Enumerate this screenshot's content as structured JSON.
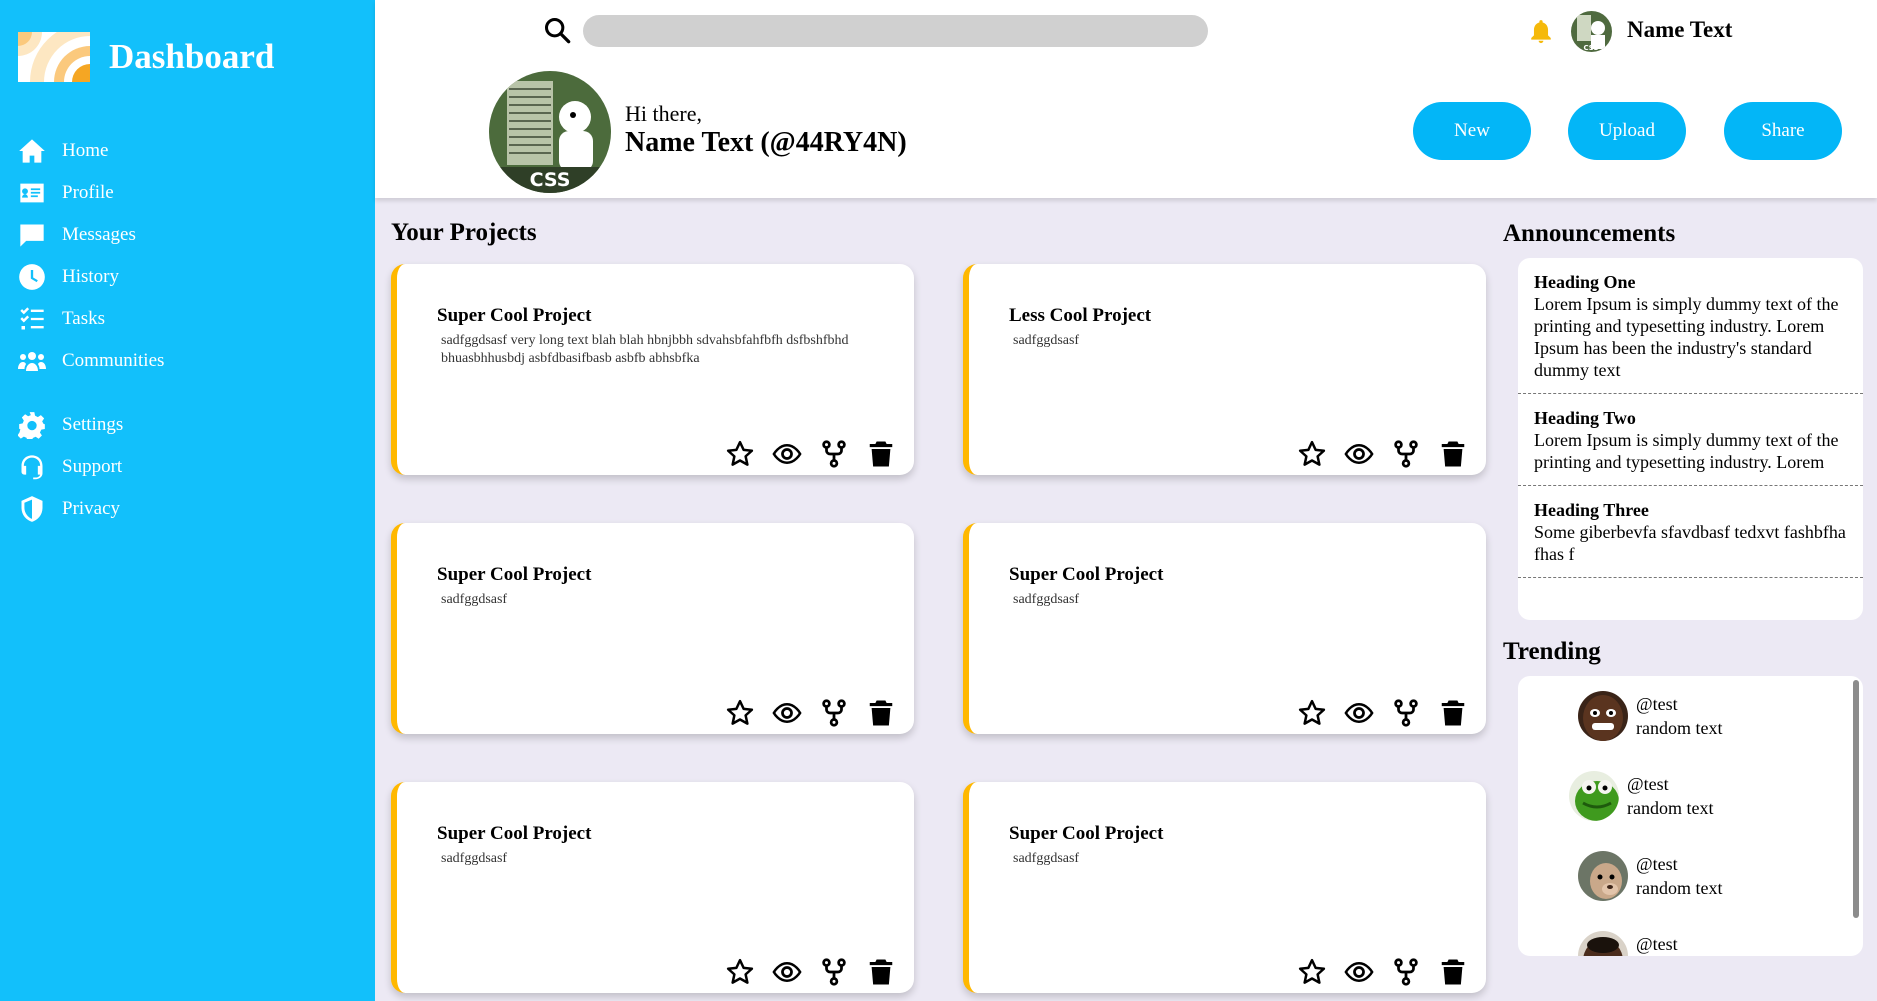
{
  "sidebar": {
    "title": "Dashboard",
    "items": [
      {
        "label": "Home",
        "icon": "home-icon"
      },
      {
        "label": "Profile",
        "icon": "id-card-icon"
      },
      {
        "label": "Messages",
        "icon": "chat-icon"
      },
      {
        "label": "History",
        "icon": "clock-icon"
      },
      {
        "label": "Tasks",
        "icon": "tasks-icon"
      },
      {
        "label": "Communities",
        "icon": "people-icon"
      }
    ],
    "bottom_items": [
      {
        "label": "Settings",
        "icon": "gear-icon"
      },
      {
        "label": "Support",
        "icon": "headset-icon"
      },
      {
        "label": "Privacy",
        "icon": "shield-icon"
      }
    ]
  },
  "header": {
    "search_placeholder": "",
    "user_name": "Name Text",
    "greeting": "Hi there,",
    "greeting_name": "Name Text (@44RY4N)",
    "buttons": {
      "new": "New",
      "upload": "Upload",
      "share": "Share"
    }
  },
  "projects": {
    "title": "Your Projects",
    "items": [
      {
        "title": "Super Cool Project",
        "desc": "sadfggdsasf very long text blah blah hbnjbbh sdvahsbfahfbfh dsfbshfbhd bhuasbhhusbdj asbfdbasifbasb asbfb abhsbfka"
      },
      {
        "title": "Less Cool Project",
        "desc": "sadfggdsasf"
      },
      {
        "title": "Super Cool Project",
        "desc": "sadfggdsasf"
      },
      {
        "title": "Super Cool Project",
        "desc": "sadfggdsasf"
      },
      {
        "title": "Super Cool Project",
        "desc": "sadfggdsasf"
      },
      {
        "title": "Super Cool Project",
        "desc": "sadfggdsasf"
      }
    ]
  },
  "announcements": {
    "title": "Announcements",
    "items": [
      {
        "heading": "Heading One",
        "body": "Lorem Ipsum is simply dummy text of the printing and typesetting industry. Lorem Ipsum has been the industry's standard dummy text"
      },
      {
        "heading": "Heading Two",
        "body": "Lorem Ipsum is simply dummy text of the printing and typesetting industry. Lorem"
      },
      {
        "heading": "Heading Three",
        "body": "Some giberbevfa sfavdbasf tedxvt fashbfha fhas f"
      }
    ]
  },
  "trending": {
    "title": "Trending",
    "items": [
      {
        "handle": "@test",
        "text": "random text"
      },
      {
        "handle": "@test",
        "text": "random text"
      },
      {
        "handle": "@test",
        "text": "random text"
      },
      {
        "handle": "@test",
        "text": ""
      }
    ]
  },
  "colors": {
    "sidebar": "#12c0fb",
    "accent": "#03b6f7",
    "card_border": "#ffb800",
    "background": "#ece9f4",
    "bell": "#f5b90a"
  }
}
